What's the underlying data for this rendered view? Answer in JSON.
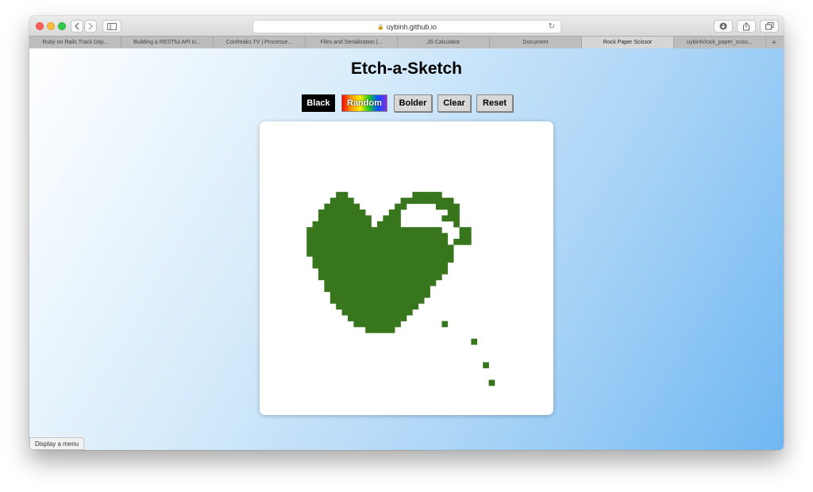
{
  "browser": {
    "url": "uybinh.github.io",
    "tabs": [
      {
        "label": "Ruby on Rails Track Day...",
        "active": false
      },
      {
        "label": "Building a RESTful API in...",
        "active": false
      },
      {
        "label": "Confreaks TV | Processe...",
        "active": false
      },
      {
        "label": "Files and Serialization |...",
        "active": false
      },
      {
        "label": "JS Calculator",
        "active": false
      },
      {
        "label": "Document",
        "active": false
      },
      {
        "label": "Rock Paper Scissor",
        "active": true
      },
      {
        "label": "uybinh/rock_paper_sciss...",
        "active": false
      }
    ],
    "status_text": "Display a menu"
  },
  "page": {
    "title": "Etch-a-Sketch",
    "buttons": {
      "black": "Black",
      "random": "Random",
      "bolder": "Bolder",
      "clear": "Clear",
      "reset": "Reset"
    }
  },
  "sketch": {
    "color": "#38761d",
    "grid_size": 50,
    "drawing": [
      "..................................................",
      "..................................................",
      "..................................................",
      "..................................................",
      "..................................................",
      "..................................................",
      "..................................................",
      "..................................................",
      "..................................................",
      "..................................................",
      "..................................................",
      "..................................................",
      ".............##...........#####..................",
      "............####........#########................",
      "...........######......##.....####...............",
      "..........########....##........##...............",
      "..........#########..###.......###...............",
      ".........##########.####.........#...............",
      "........#######################...##.............",
      "........########################..##.............",
      "........########################.###.............",
      "........#########################...............",
      "........#########################...............",
      ".........########################...............",
      ".........#######################................",
      "..........######################................",
      "..........#####################.................",
      "...........###################..................",
      "...........##################...................",
      "............#################...................",
      "............################....................",
      ".............##############.....................",
      "..............############......................",
      "...............##########.......................",
      "................########.......#.................",
      "..................#####..........................",
      "...............................................",
      "....................................#.............",
      "..................................................",
      "..................................................",
      "..................................................",
      "......................................#...........",
      "..................................................",
      "..................................................",
      ".......................................#..........",
      "..................................................",
      "..................................................",
      "..................................................",
      "..................................................",
      ".................................................."
    ]
  }
}
